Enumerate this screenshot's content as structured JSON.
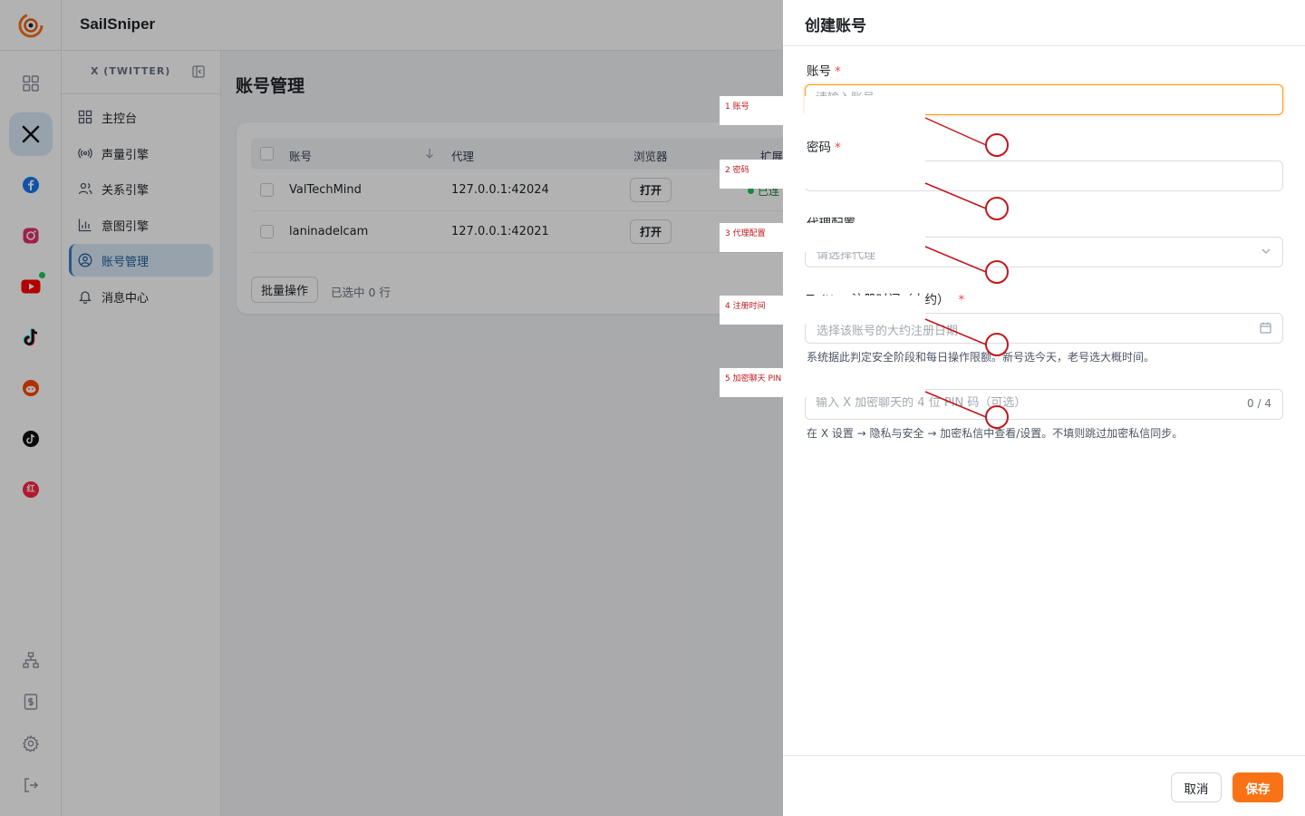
{
  "app": {
    "brand": "SailSniper"
  },
  "rail": {
    "items": [
      {
        "name": "dashboard-grid"
      },
      {
        "name": "x-twitter",
        "active": true
      },
      {
        "name": "facebook"
      },
      {
        "name": "instagram"
      },
      {
        "name": "youtube",
        "badge": true
      },
      {
        "name": "tiktok"
      },
      {
        "name": "reddit"
      },
      {
        "name": "tiktok-alt"
      },
      {
        "name": "xiaohongshu",
        "glyph": "红"
      }
    ],
    "bottom": [
      {
        "name": "sitemap"
      },
      {
        "name": "billing"
      },
      {
        "name": "settings"
      },
      {
        "name": "logout"
      }
    ]
  },
  "sidebar": {
    "title": "X (TWITTER)",
    "items": [
      {
        "label": "主控台",
        "icon": "grid-icon"
      },
      {
        "label": "声量引擎",
        "icon": "broadcast-icon"
      },
      {
        "label": "关系引擎",
        "icon": "users-icon"
      },
      {
        "label": "意图引擎",
        "icon": "bar-chart-icon"
      },
      {
        "label": "账号管理",
        "icon": "user-circle-icon",
        "active": true
      },
      {
        "label": "消息中心",
        "icon": "bell-icon"
      }
    ]
  },
  "main": {
    "title": "账号管理",
    "table": {
      "columns": [
        "账号",
        "代理",
        "浏览器",
        "扩展"
      ],
      "rows": [
        {
          "account": "ValTechMind",
          "proxy": "127.0.0.1:42024",
          "browser_btn": "打开",
          "status": "已连"
        },
        {
          "account": "laninadelcam",
          "proxy": "127.0.0.1:42021",
          "browser_btn": "打开",
          "status": ""
        }
      ],
      "bulk_label": "批量操作",
      "selected_text": "已选中 0 行"
    }
  },
  "drawer": {
    "title": "创建账号",
    "account": {
      "label": "账号",
      "placeholder": "请输入账号",
      "required": "*"
    },
    "password": {
      "label": "密码",
      "placeholder": "",
      "required": "*"
    },
    "proxy": {
      "label": "代理配置",
      "placeholder": "请选择代理"
    },
    "reg_time": {
      "label": "Twitter 注册时间（大约）",
      "required": "*",
      "placeholder": "选择该账号的大约注册日期",
      "help": "系统据此判定安全阶段和每日操作限额。新号选今天，老号选大概时间。"
    },
    "pin": {
      "placeholder": "输入 X 加密聊天的 4 位 PIN 码（可选）",
      "counter": "0 / 4",
      "help": "在 X 设置 → 隐私与安全 → 加密私信中查看/设置。不填则跳过加密私信同步。"
    },
    "cancel": "取消",
    "save": "保存"
  },
  "annotations": [
    {
      "text": "1 账号"
    },
    {
      "text": "2 密码"
    },
    {
      "text": "3 代理配置"
    },
    {
      "text": "4 注册时间"
    },
    {
      "text": "5 加密聊天 PIN"
    }
  ],
  "colors": {
    "accent": "#f97316",
    "active_nav": "#d8e8f6",
    "annotation": "#c0171d",
    "status_green": "#22c55e"
  }
}
